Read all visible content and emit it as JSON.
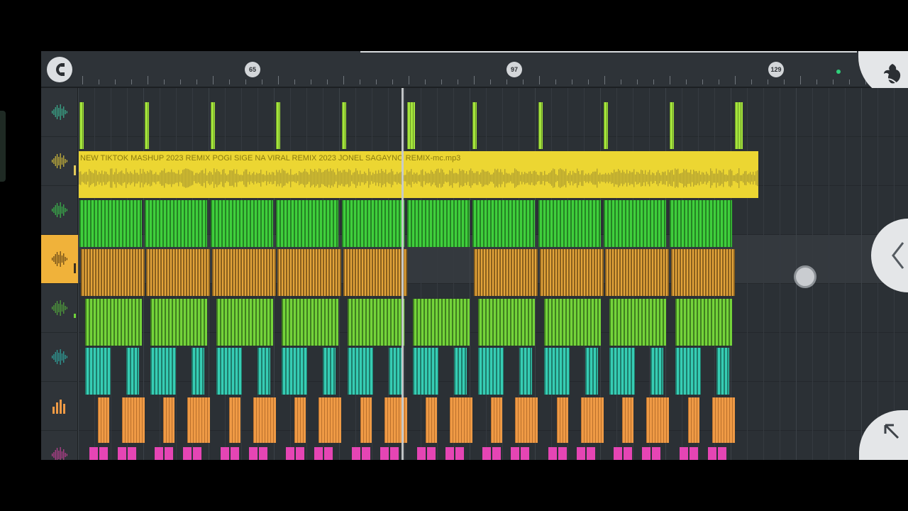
{
  "ruler": {
    "markers": [
      "65",
      "97",
      "129"
    ],
    "magnet_icon": "magnet-snap-icon",
    "logo_icon": "fl-fruit-logo-icon"
  },
  "audio_clip": {
    "title": "NEW TIKTOK MASHUP 2023 REMIX POGI SIGE NA VIRAL REMIX 2023 JONEL SAGAYNO REMIX-mc.mp3"
  },
  "tracks": [
    {
      "icon": "waveform-icon",
      "color": "#9be03a"
    },
    {
      "icon": "waveform-icon",
      "color": "#ecd632"
    },
    {
      "icon": "waveform-icon",
      "color": "#49d13a"
    },
    {
      "icon": "waveform-icon",
      "color": "#e0a23a",
      "selected": true
    },
    {
      "icon": "waveform-icon",
      "color": "#6fd33a"
    },
    {
      "icon": "waveform-icon",
      "color": "#35cdb2"
    },
    {
      "icon": "levels-icon",
      "color": "#ef9a45"
    },
    {
      "icon": "waveform-icon",
      "color": "#e545b4"
    }
  ],
  "colors": {
    "background": "#2b3035",
    "accent_orange": "#f0b23a",
    "playhead": "#c8cbce"
  },
  "buttons": {
    "back_icon": "chevron-left-icon",
    "expand_icon": "arrow-up-left-icon"
  }
}
